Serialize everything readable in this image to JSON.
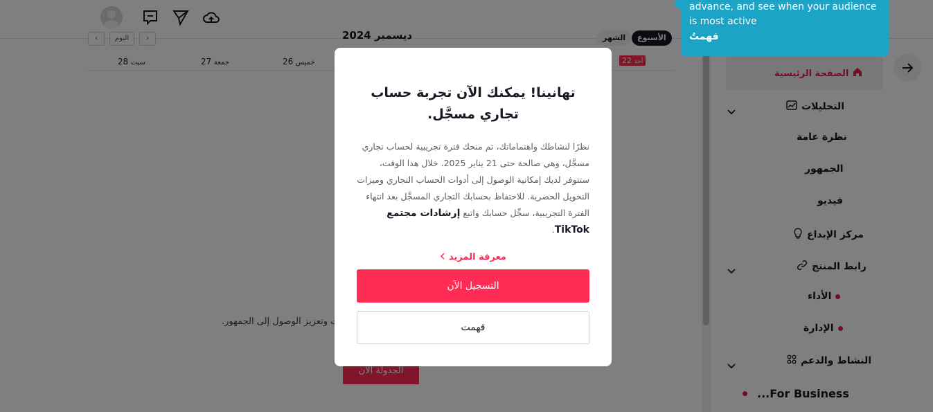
{
  "topbar": {
    "icons": [
      "avatar",
      "message-icon",
      "send-icon",
      "upload-cloud-icon"
    ]
  },
  "calendar": {
    "month_title": "ديسمبر 2024",
    "prev_label": "‹",
    "today_label": "اليوم",
    "next_label": "›",
    "view_week": "الأسبوع",
    "view_month": "الشهر",
    "days": [
      {
        "name": "سبت",
        "num": "28"
      },
      {
        "name": "جمعة",
        "num": "27"
      },
      {
        "name": "خميس",
        "num": "26"
      }
    ],
    "today": {
      "name": "أحد",
      "num": "22"
    },
    "empty_text": "ت وتعزيز الوصول إلى الجمهور.",
    "schedule_button": "الجدولة الآن"
  },
  "sidebar": {
    "home": "الصفحة الرئيسية",
    "analytics": "التحليلات",
    "overview": "نظرة عامة",
    "audience": "الجمهور",
    "video": "فيديو",
    "creator_center": "مركز الإبداع",
    "product_link": "رابط المنتج",
    "performance": "الأداء",
    "management": "الإدارة",
    "activity_support": "النشاط والدعم",
    "for_business": "...For Business"
  },
  "tooltip": {
    "text": "advance, and see when your audience is most active",
    "button": "فهمتُ"
  },
  "modal": {
    "title": "تهانينا! يمكنك الآن تجربة حساب تجاري مسجَّل.",
    "body_prefix": "نظرًا لنشاطك واهتماماتك، تم منحك فترة تجريبية لحساب تجاري مسجَّل، وهي صالحة حتى 21 يناير 2025. خلال هذا الوقت، ستتوفر لديك إمكانية الوصول إلى أدوات الحساب التجاري وميزات التحويل الحصرية. للاحتفاظ بحسابك التجاري المسجَّل بعد انتهاء الفترة التجريبية، سجِّل حسابك واتبع ",
    "body_bold": "إرشادات مجتمع TikTok",
    "body_suffix": ".",
    "learn_more": "معرفة المزيد",
    "primary_button": "التسجيل الآن",
    "secondary_button": "فهمت"
  },
  "colors": {
    "accent": "#fe2c55",
    "tooltip_bg": "#1ba4c6",
    "overlay": "rgba(0,0,0,0.5)"
  }
}
